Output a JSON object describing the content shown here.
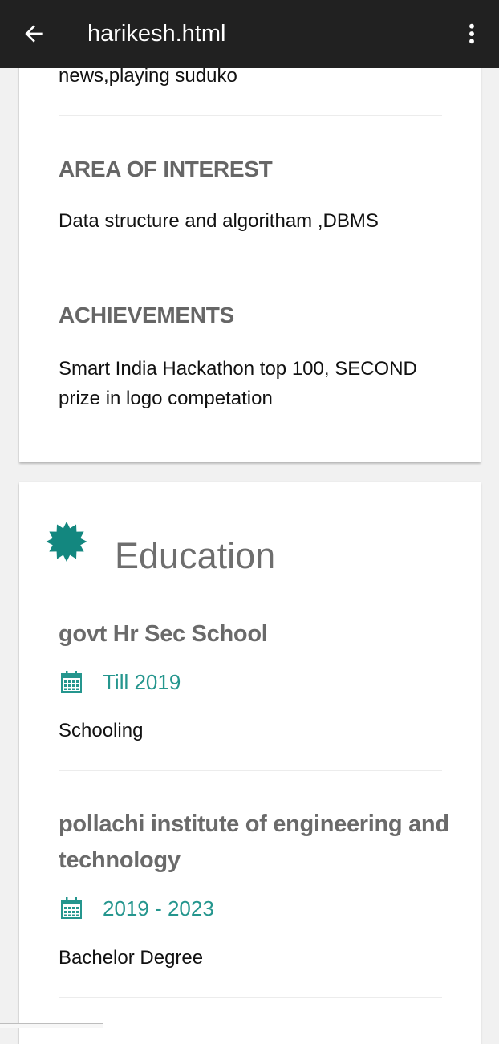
{
  "appbar": {
    "title": "harikesh.html",
    "back_icon": "arrow-left-icon",
    "menu_icon": "more-vert-icon"
  },
  "about": {
    "hobbies_tail": "news,playing suduko",
    "area_of_interest": {
      "heading": "AREA OF INTEREST",
      "text": "Data structure and algoritham ,DBMS"
    },
    "achievements": {
      "heading": "ACHIEVEMENTS",
      "text": "Smart India Hackathon top 100, SECOND prize in logo competation"
    }
  },
  "education": {
    "title": "Education",
    "icon": "badge-star-icon",
    "accent_color": "#25968e",
    "items": [
      {
        "school": "govt Hr Sec School",
        "date": "Till 2019",
        "description": "Schooling"
      },
      {
        "school": "pollachi institute of engineering and technology",
        "date": "2019 - 2023",
        "description": "Bachelor Degree"
      }
    ]
  }
}
